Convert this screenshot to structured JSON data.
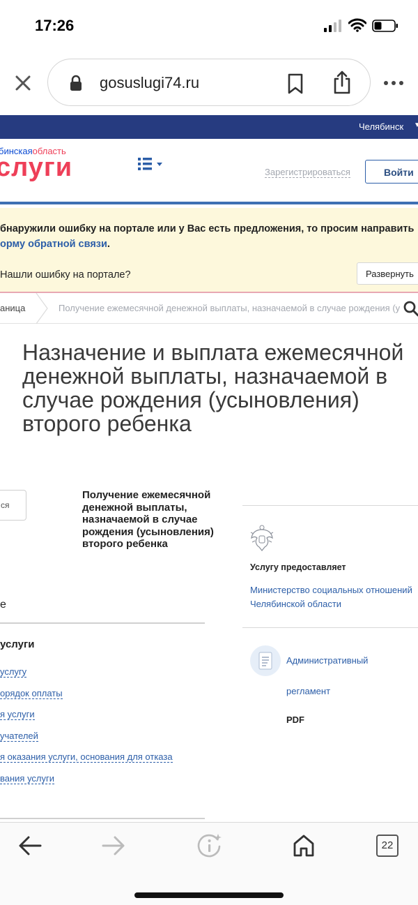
{
  "status_bar": {
    "time": "17:26",
    "signal_icon": "cellular-signal-icon",
    "wifi_icon": "wifi-icon",
    "battery_icon": "battery-icon"
  },
  "browser": {
    "url": "gosuslugi74.ru",
    "close_icon": "close-icon",
    "lock_icon": "lock-icon",
    "bookmark_icon": "bookmark-icon",
    "share_icon": "share-icon",
    "more_icon": "more-icon"
  },
  "site": {
    "region": "Челябинск",
    "logo_region_a": "бинская",
    "logo_region_b": "область",
    "logo_main": "слуги",
    "register_label": "Зарегистрироваться",
    "login_label": "Войти",
    "colors": {
      "navy": "#263b80",
      "brand_red": "#ee3f58",
      "link_blue": "#2c5ea8",
      "banner_bg": "#fdf8dc"
    }
  },
  "feedback": {
    "line1": "бнаружили ошибку на портале или у Вас есть предложения, то просим направить",
    "line2_link": "орму обратной связи",
    "line2_end": ".",
    "question": "Нашли ошибку на портале?",
    "expand_label": "Развернуть"
  },
  "breadcrumb": {
    "home": "аница",
    "current": "Получение ежемесячной денежной выплаты, назначаемой в случае рождения (у…"
  },
  "page": {
    "title": "Назначение и выплата ежемесячной денежной выплаты, назначаемой в случае рождения (усыновления) второго ребенка",
    "partial_button": "ся",
    "subtitle": "Получение ежемесячной денежной выплаты, назначаемой в случае рождения (усыновления) второго ребенка",
    "section_partial": "е",
    "nav_heading": "услуги",
    "nav_items": [
      "услугу",
      "орядок оплаты",
      "я услуги",
      "учателей",
      "я оказания услуги, основания для отказа",
      "вания услуги"
    ]
  },
  "sidebar": {
    "provider_label": "Услугу предоставляет",
    "provider_name": "Министерство социальных отношений Челябинской области",
    "regulation_line1": "Административный",
    "regulation_line2": "регламент",
    "regulation_format": "PDF"
  },
  "toolbar": {
    "tabs_count": "22"
  }
}
